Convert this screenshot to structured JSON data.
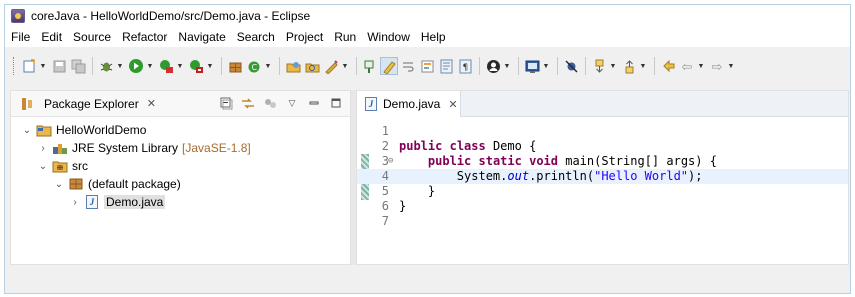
{
  "window": {
    "title": "coreJava - HelloWorldDemo/src/Demo.java - Eclipse"
  },
  "menu": [
    "File",
    "Edit",
    "Source",
    "Refactor",
    "Navigate",
    "Search",
    "Project",
    "Run",
    "Window",
    "Help"
  ],
  "package_explorer": {
    "tab_label": "Package Explorer",
    "tree": [
      {
        "label": "HelloWorldDemo",
        "decoration": ""
      },
      {
        "label": "JRE System Library",
        "decoration": "[JavaSE-1.8]"
      },
      {
        "label": "src",
        "decoration": ""
      },
      {
        "label": "(default package)",
        "decoration": ""
      },
      {
        "label": "Demo.java",
        "decoration": ""
      }
    ]
  },
  "editor": {
    "tab_label": "Demo.java",
    "line_numbers": [
      "1",
      "2",
      "3",
      "4",
      "5",
      "6",
      "7"
    ],
    "code": {
      "l2_kw1": "public",
      "l2_kw2": "class",
      "l2_name": "Demo {",
      "l3_kw1": "public",
      "l3_kw2": "static",
      "l3_kw3": "void",
      "l3_sig": "main(String[] args) {",
      "l4_obj": "System.",
      "l4_field": "out",
      "l4_call": ".println(",
      "l4_str": "\"Hello World\"",
      "l4_end": ");",
      "l5": "}",
      "l6": "}"
    }
  },
  "colors": {
    "keyword": "#7f0055",
    "string": "#2a00ff",
    "field": "#0000c0",
    "current_line": "#e8f2fe"
  }
}
